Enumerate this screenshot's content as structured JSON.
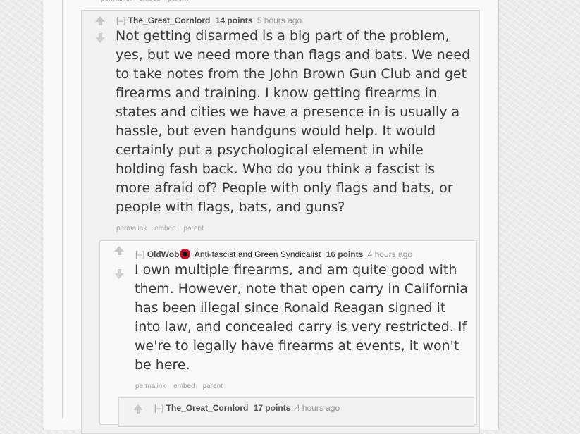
{
  "top_remnant": {
    "buttons": [
      "permalink",
      "embed",
      "parent"
    ]
  },
  "comments": [
    {
      "expand": "[–]",
      "author": "The_Great_Cornlord",
      "score": "14 points",
      "time": "5 hours ago",
      "body": "Not getting disarmed is a big part of the problem,\nyes, but we need more than flags and bats. We need\nto take notes from the John Brown Gun Club and get\nfirearms and training. I know getting firearms in\nstates and cities we have a presence in is usually a\nhassle, but even handguns would help. It would\ncertainly put a psychological element in while\nholding fash back. Who do you think a fascist is\nmore afraid of? People with only flags and bats, or\npeople with flags, bats, and guns?",
      "buttons": [
        "permalink",
        "embed",
        "parent"
      ]
    },
    {
      "expand": "[–]",
      "author": "OldWob",
      "flair_icon": "anarchist-flag-icon",
      "flair": "Anti-fascist and Green Syndicalist",
      "score": "16 points",
      "time": "4 hours ago",
      "body": "I own multiple firearms, and am quite good with\nthem. However, note that open carry in California\nhas been illegal since Ronald Reagan signed it\ninto law, and concealed carry is very restricted. If\nwe're to legally have firearms at events, it won't\nbe here.",
      "buttons": [
        "permalink",
        "embed",
        "parent"
      ]
    },
    {
      "expand": "[–]",
      "author": "The_Great_Cornlord",
      "score": "17 points",
      "time": "4 hours ago"
    }
  ]
}
